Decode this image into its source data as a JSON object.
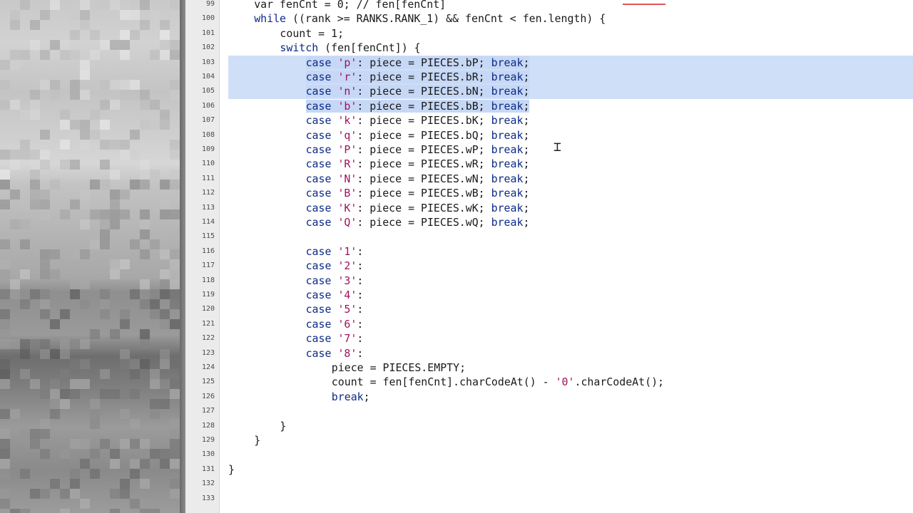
{
  "editor": {
    "line_numbers": [
      "99",
      "100",
      "101",
      "102",
      "103",
      "104",
      "105",
      "106",
      "107",
      "108",
      "109",
      "110",
      "111",
      "112",
      "113",
      "114",
      "115",
      "116",
      "117",
      "118",
      "119",
      "120",
      "121",
      "122",
      "123",
      "124",
      "125",
      "126",
      "127",
      "128",
      "129",
      "130",
      "131",
      "132",
      "133"
    ],
    "lines": [
      {
        "indent": "    ",
        "parts": [
          {
            "t": "var fenCnt = 0; // fen[fenCnt]",
            "c": "plain"
          }
        ]
      },
      {
        "indent": "    ",
        "parts": [
          {
            "t": "while",
            "c": "kw"
          },
          {
            "t": " ((rank >= RANKS.RANK_1) && fenCnt < fen.length) {",
            "c": "plain"
          }
        ]
      },
      {
        "indent": "        ",
        "parts": [
          {
            "t": "count = 1;",
            "c": "plain"
          }
        ]
      },
      {
        "indent": "        ",
        "parts": [
          {
            "t": "switch",
            "c": "kw"
          },
          {
            "t": " (fen[fenCnt]) {",
            "c": "plain"
          }
        ]
      },
      {
        "indent": "            ",
        "parts": [
          {
            "t": "case",
            "c": "kw"
          },
          {
            "t": " ",
            "c": "plain"
          },
          {
            "t": "'p'",
            "c": "str"
          },
          {
            "t": ": piece = PIECES.bP; ",
            "c": "plain"
          },
          {
            "t": "break",
            "c": "kw"
          },
          {
            "t": ";",
            "c": "plain"
          }
        ]
      },
      {
        "indent": "            ",
        "parts": [
          {
            "t": "case",
            "c": "kw"
          },
          {
            "t": " ",
            "c": "plain"
          },
          {
            "t": "'r'",
            "c": "str"
          },
          {
            "t": ": piece = PIECES.bR; ",
            "c": "plain"
          },
          {
            "t": "break",
            "c": "kw"
          },
          {
            "t": ";",
            "c": "plain"
          }
        ]
      },
      {
        "indent": "            ",
        "parts": [
          {
            "t": "case",
            "c": "kw"
          },
          {
            "t": " ",
            "c": "plain"
          },
          {
            "t": "'n'",
            "c": "str"
          },
          {
            "t": ": piece = PIECES.bN; ",
            "c": "plain"
          },
          {
            "t": "break",
            "c": "kw"
          },
          {
            "t": ";",
            "c": "plain"
          }
        ]
      },
      {
        "indent": "            ",
        "parts": [
          {
            "t": "case",
            "c": "kw"
          },
          {
            "t": " ",
            "c": "plain"
          },
          {
            "t": "'b'",
            "c": "str"
          },
          {
            "t": ": piece = PIECES.bB; ",
            "c": "plain"
          },
          {
            "t": "break",
            "c": "kw"
          },
          {
            "t": ";",
            "c": "plain"
          }
        ]
      },
      {
        "indent": "            ",
        "parts": [
          {
            "t": "case",
            "c": "kw"
          },
          {
            "t": " ",
            "c": "plain"
          },
          {
            "t": "'k'",
            "c": "str"
          },
          {
            "t": ": piece = PIECES.bK; ",
            "c": "plain"
          },
          {
            "t": "break",
            "c": "kw"
          },
          {
            "t": ";",
            "c": "plain"
          }
        ]
      },
      {
        "indent": "            ",
        "parts": [
          {
            "t": "case",
            "c": "kw"
          },
          {
            "t": " ",
            "c": "plain"
          },
          {
            "t": "'q'",
            "c": "str"
          },
          {
            "t": ": piece = PIECES.bQ; ",
            "c": "plain"
          },
          {
            "t": "break",
            "c": "kw"
          },
          {
            "t": ";",
            "c": "plain"
          }
        ]
      },
      {
        "indent": "            ",
        "parts": [
          {
            "t": "case",
            "c": "kw"
          },
          {
            "t": " ",
            "c": "plain"
          },
          {
            "t": "'P'",
            "c": "str"
          },
          {
            "t": ": piece = PIECES.wP; ",
            "c": "plain"
          },
          {
            "t": "break",
            "c": "kw"
          },
          {
            "t": ";",
            "c": "plain"
          }
        ]
      },
      {
        "indent": "            ",
        "parts": [
          {
            "t": "case",
            "c": "kw"
          },
          {
            "t": " ",
            "c": "plain"
          },
          {
            "t": "'R'",
            "c": "str"
          },
          {
            "t": ": piece = PIECES.wR; ",
            "c": "plain"
          },
          {
            "t": "break",
            "c": "kw"
          },
          {
            "t": ";",
            "c": "plain"
          }
        ]
      },
      {
        "indent": "            ",
        "parts": [
          {
            "t": "case",
            "c": "kw"
          },
          {
            "t": " ",
            "c": "plain"
          },
          {
            "t": "'N'",
            "c": "str"
          },
          {
            "t": ": piece = PIECES.wN; ",
            "c": "plain"
          },
          {
            "t": "break",
            "c": "kw"
          },
          {
            "t": ";",
            "c": "plain"
          }
        ]
      },
      {
        "indent": "            ",
        "parts": [
          {
            "t": "case",
            "c": "kw"
          },
          {
            "t": " ",
            "c": "plain"
          },
          {
            "t": "'B'",
            "c": "str"
          },
          {
            "t": ": piece = PIECES.wB; ",
            "c": "plain"
          },
          {
            "t": "break",
            "c": "kw"
          },
          {
            "t": ";",
            "c": "plain"
          }
        ]
      },
      {
        "indent": "            ",
        "parts": [
          {
            "t": "case",
            "c": "kw"
          },
          {
            "t": " ",
            "c": "plain"
          },
          {
            "t": "'K'",
            "c": "str"
          },
          {
            "t": ": piece = PIECES.wK; ",
            "c": "plain"
          },
          {
            "t": "break",
            "c": "kw"
          },
          {
            "t": ";",
            "c": "plain"
          }
        ]
      },
      {
        "indent": "            ",
        "parts": [
          {
            "t": "case",
            "c": "kw"
          },
          {
            "t": " ",
            "c": "plain"
          },
          {
            "t": "'Q'",
            "c": "str"
          },
          {
            "t": ": piece = PIECES.wQ; ",
            "c": "plain"
          },
          {
            "t": "break",
            "c": "kw"
          },
          {
            "t": ";",
            "c": "plain"
          }
        ]
      },
      {
        "indent": "",
        "parts": []
      },
      {
        "indent": "            ",
        "parts": [
          {
            "t": "case",
            "c": "kw"
          },
          {
            "t": " ",
            "c": "plain"
          },
          {
            "t": "'1'",
            "c": "str"
          },
          {
            "t": ":",
            "c": "plain"
          }
        ]
      },
      {
        "indent": "            ",
        "parts": [
          {
            "t": "case",
            "c": "kw"
          },
          {
            "t": " ",
            "c": "plain"
          },
          {
            "t": "'2'",
            "c": "str"
          },
          {
            "t": ":",
            "c": "plain"
          }
        ]
      },
      {
        "indent": "            ",
        "parts": [
          {
            "t": "case",
            "c": "kw"
          },
          {
            "t": " ",
            "c": "plain"
          },
          {
            "t": "'3'",
            "c": "str"
          },
          {
            "t": ":",
            "c": "plain"
          }
        ]
      },
      {
        "indent": "            ",
        "parts": [
          {
            "t": "case",
            "c": "kw"
          },
          {
            "t": " ",
            "c": "plain"
          },
          {
            "t": "'4'",
            "c": "str"
          },
          {
            "t": ":",
            "c": "plain"
          }
        ]
      },
      {
        "indent": "            ",
        "parts": [
          {
            "t": "case",
            "c": "kw"
          },
          {
            "t": " ",
            "c": "plain"
          },
          {
            "t": "'5'",
            "c": "str"
          },
          {
            "t": ":",
            "c": "plain"
          }
        ]
      },
      {
        "indent": "            ",
        "parts": [
          {
            "t": "case",
            "c": "kw"
          },
          {
            "t": " ",
            "c": "plain"
          },
          {
            "t": "'6'",
            "c": "str"
          },
          {
            "t": ":",
            "c": "plain"
          }
        ]
      },
      {
        "indent": "            ",
        "parts": [
          {
            "t": "case",
            "c": "kw"
          },
          {
            "t": " ",
            "c": "plain"
          },
          {
            "t": "'7'",
            "c": "str"
          },
          {
            "t": ":",
            "c": "plain"
          }
        ]
      },
      {
        "indent": "            ",
        "parts": [
          {
            "t": "case",
            "c": "kw"
          },
          {
            "t": " ",
            "c": "plain"
          },
          {
            "t": "'8'",
            "c": "str"
          },
          {
            "t": ":",
            "c": "plain"
          }
        ]
      },
      {
        "indent": "                ",
        "parts": [
          {
            "t": "piece = PIECES.EMPTY;",
            "c": "plain"
          }
        ]
      },
      {
        "indent": "                ",
        "parts": [
          {
            "t": "count = fen[fenCnt].charCodeAt() - ",
            "c": "plain"
          },
          {
            "t": "'0'",
            "c": "str"
          },
          {
            "t": ".charCodeAt();",
            "c": "plain"
          }
        ]
      },
      {
        "indent": "                ",
        "parts": [
          {
            "t": "break",
            "c": "kw"
          },
          {
            "t": ";",
            "c": "plain"
          }
        ]
      },
      {
        "indent": "",
        "parts": []
      },
      {
        "indent": "        ",
        "parts": [
          {
            "t": "}",
            "c": "plain"
          }
        ]
      },
      {
        "indent": "    ",
        "parts": [
          {
            "t": "}",
            "c": "plain"
          }
        ]
      },
      {
        "indent": "",
        "parts": []
      },
      {
        "indent": "",
        "parts": [
          {
            "t": "}",
            "c": "plain"
          }
        ]
      },
      {
        "indent": "",
        "parts": []
      },
      {
        "indent": "",
        "parts": []
      }
    ],
    "selected_line_indices": [
      4,
      5,
      6,
      7
    ],
    "current_line_indices": [
      4,
      5,
      6
    ],
    "colors": {
      "keyword": "#0c2a86",
      "string": "#a0125e",
      "selection": "#c6d8f5",
      "current_line": "#cfdff7"
    }
  }
}
